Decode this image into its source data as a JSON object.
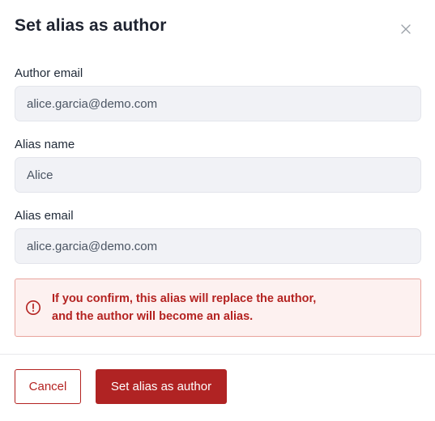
{
  "dialog": {
    "title": "Set alias as author",
    "close_icon": "close-icon"
  },
  "fields": {
    "author_email": {
      "label": "Author email",
      "value": "alice.garcia@demo.com"
    },
    "alias_name": {
      "label": "Alias name",
      "value": "Alice"
    },
    "alias_email": {
      "label": "Alias email",
      "value": "alice.garcia@demo.com"
    }
  },
  "warning": {
    "icon": "alert-circle-icon",
    "line1": "If you confirm, this alias will replace the author,",
    "line2": "and the author will become an alias."
  },
  "footer": {
    "cancel_label": "Cancel",
    "confirm_label": "Set alias as author"
  },
  "colors": {
    "accent": "#b02323",
    "warning_bg": "#fdf1f0",
    "warning_border": "#e8a39c",
    "input_bg": "#f1f2f6"
  }
}
